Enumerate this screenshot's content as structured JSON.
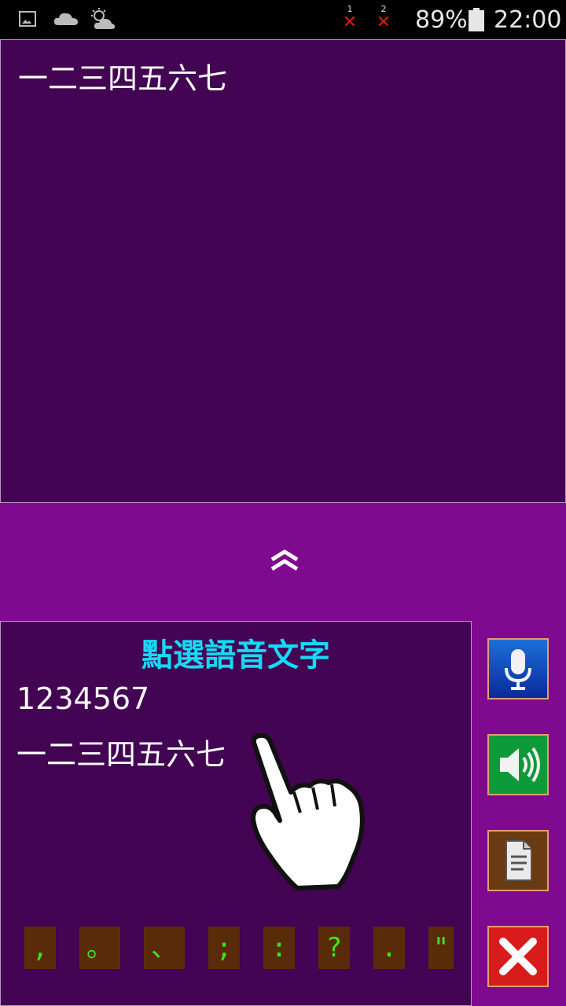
{
  "status_bar": {
    "battery_percent": "89%",
    "time": "22:00",
    "sim1_label": "1",
    "sim2_label": "2",
    "icons": [
      "gallery-icon",
      "cloud-icon",
      "weather-icon",
      "no-signal-icon",
      "no-signal-icon",
      "battery-icon"
    ]
  },
  "output": {
    "text": "一二三四五六七"
  },
  "panel": {
    "title": "點選語音文字",
    "options": [
      "1234567",
      "一二三四五六七"
    ],
    "punctuation": [
      ",",
      "。",
      "、",
      ";",
      ":",
      "?",
      ".",
      "\""
    ]
  },
  "side_buttons": [
    {
      "name": "microphone-icon"
    },
    {
      "name": "speaker-icon"
    },
    {
      "name": "document-icon"
    },
    {
      "name": "close-icon"
    }
  ],
  "colors": {
    "background": "#800a8f",
    "text_area": "#430453",
    "title": "#17d9f4",
    "punct_bg": "#5a2b08",
    "punct_text": "#39e61f"
  }
}
